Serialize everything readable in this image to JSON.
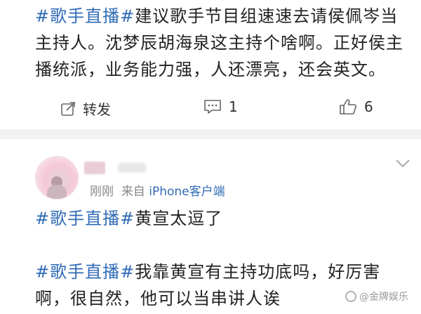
{
  "post": {
    "hashtag": "#歌手直播#",
    "text_rest": "建议歌手节目组速速去请侯佩岑当主持人。沈梦辰胡海泉这主持个啥啊。正好侯主播统派，业务能力强，人还漂亮，还会英文。"
  },
  "actions": {
    "repost_label": "转发",
    "comment_count": "1",
    "like_count": "6"
  },
  "comment": {
    "time": "刚刚",
    "source_prefix": "来自",
    "source": "iPhone客户端"
  },
  "posts_below": [
    {
      "hashtag": "#歌手直播#",
      "text": "黄宣太逗了"
    },
    {
      "hashtag": "#歌手直播#",
      "text": "我靠黄宣有主持功底吗，好厉害啊，很自然，他可以当串讲人诶"
    }
  ],
  "watermark": {
    "text": "@金牌娱乐"
  },
  "colors": {
    "link": "#2f6bb6",
    "divider": "#f2f2f2"
  }
}
